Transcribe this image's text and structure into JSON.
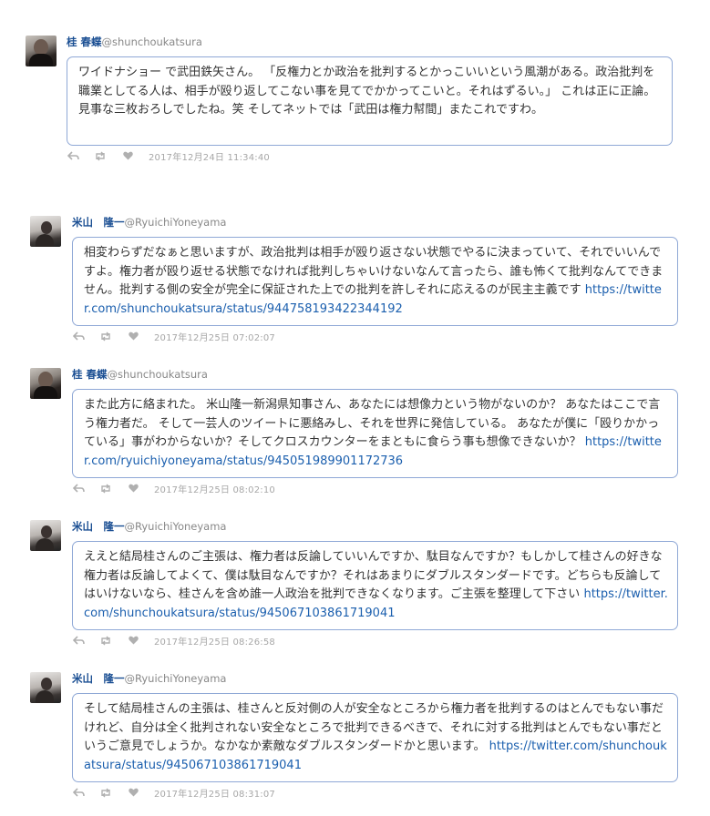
{
  "tweets": [
    {
      "display_name": "桂 春蝶",
      "handle": "@shunchoukatsura",
      "text": "ワイドナショー で武田鉄矢さん。 「反権力とか政治を批判するとかっこいいという風潮がある。政治批判を職業としてる人は、相手が殴り返してこない事を見てでかかってこいと。それはずるい。」 これは正に正論。 見事な三枚おろしでしたね。笑 そしてネットでは「武田は権力幇間」またこれですわ。",
      "link": "",
      "timestamp": "2017年12月24日 11:34:40"
    },
    {
      "display_name": "米山　隆一",
      "handle": "@RyuichiYoneyama",
      "text": "相変わらずだなぁと思いますが、政治批判は相手が殴り返さない状態でやるに決まっていて、それでいいんですよ。権力者が殴り返せる状態でなければ批判しちゃいけないなんて言ったら、誰も怖くて批判なんてできません。批判する側の安全が完全に保証された上での批判を許しそれに応えるのが民主主義です ",
      "link": "https://twitter.com/shunchoukatsura/status/944758193422344192",
      "timestamp": "2017年12月25日 07:02:07"
    },
    {
      "display_name": "桂 春蝶",
      "handle": "@shunchoukatsura",
      "text": "また此方に絡まれた。 米山隆一新潟県知事さん、あなたには想像力という物がないのか？ あなたはここで言う権力者だ。 そして一芸人のツイートに悪絡みし、それを世界に発信している。 あなたが僕に「殴りかかっている」事がわからないか？そしてクロスカウンターをまともに食らう事も想像できないか？ ",
      "link": "https://twitter.com/ryuichiyoneyama/status/945051989901172736",
      "timestamp": "2017年12月25日 08:02:10"
    },
    {
      "display_name": "米山　隆一",
      "handle": "@RyuichiYoneyama",
      "text": "ええと結局桂さんのご主張は、権力者は反論していいんですか、駄目なんですか？もしかして桂さんの好きな権力者は反論してよくて、僕は駄目なんですか？それはあまりにダブルスタンダードです。どちらも反論してはいけないなら、桂さんを含め誰一人政治を批判できなくなります。ご主張を整理して下さい ",
      "link": "https://twitter.com/shunchoukatsura/status/945067103861719041",
      "timestamp": "2017年12月25日 08:26:58"
    },
    {
      "display_name": "米山　隆一",
      "handle": "@RyuichiYoneyama",
      "text": "そして結局桂さんの主張は、桂さんと反対側の人が安全なところから権力者を批判するのはとんでもない事だけれど、自分は全く批判されない安全なところで批判できるべきで、それに対する批判はとんでもない事だというご意見でしょうか。なかなか素敵なダブルスタンダードかと思います。 ",
      "link": "https://twitter.com/shunchoukatsura/status/945067103861719041",
      "timestamp": "2017年12月25日 08:31:07"
    }
  ],
  "icons": {
    "reply": "reply-icon",
    "retweet": "retweet-icon",
    "like": "heart-icon"
  },
  "colors": {
    "name": "#1b4f93",
    "bubble_border": "#8fa8d6",
    "link": "#1b5fae"
  }
}
